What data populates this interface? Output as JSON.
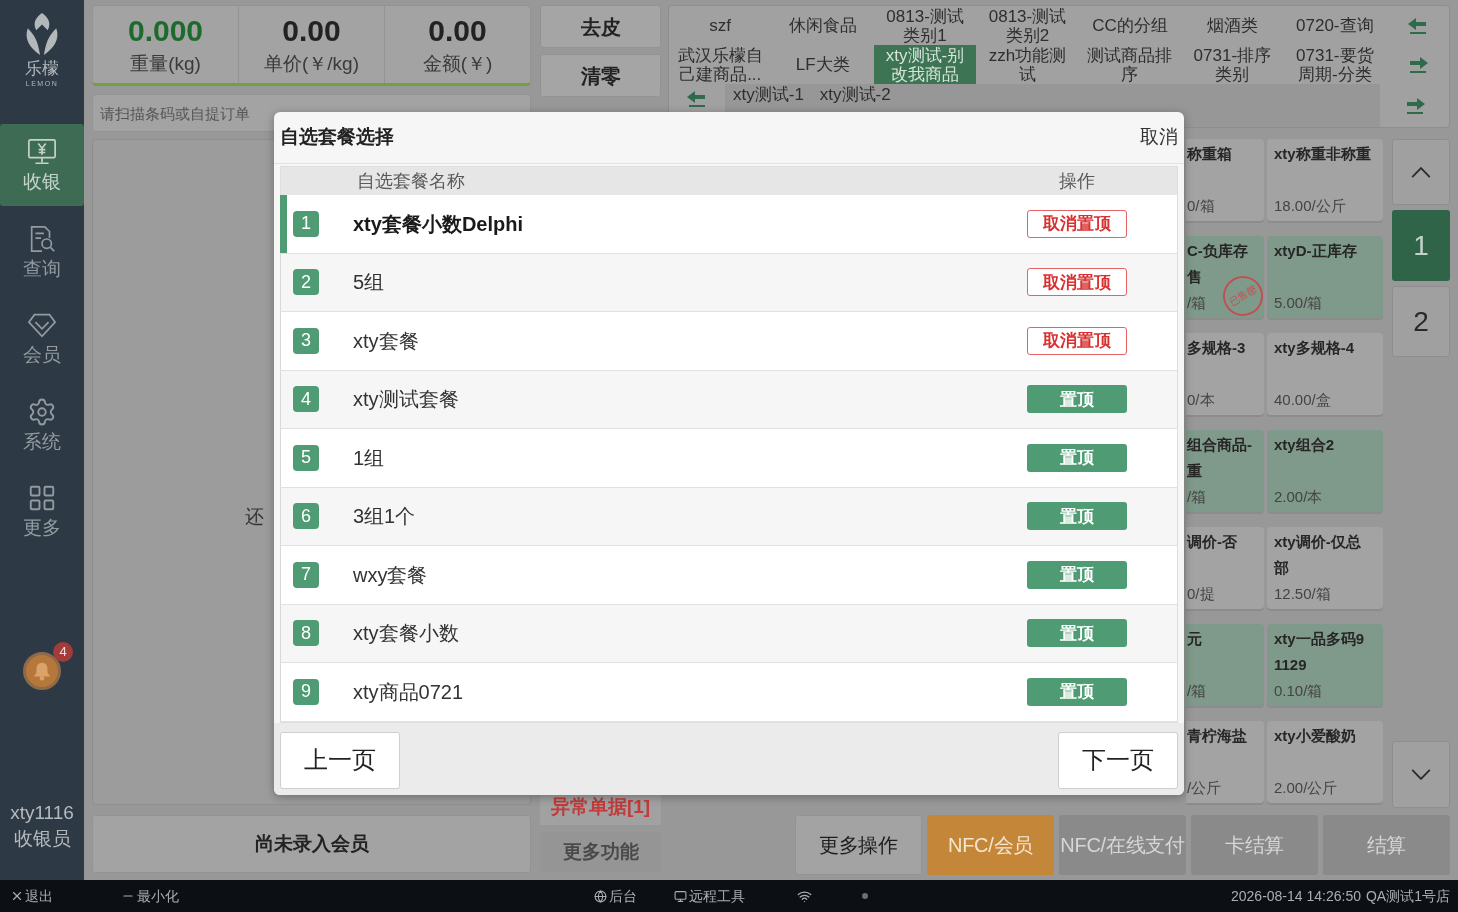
{
  "sidebar": {
    "logo": {
      "name": "乐檬",
      "subtitle": "LEMON"
    },
    "items": [
      {
        "label": "收银",
        "selected": true
      },
      {
        "label": "查询",
        "selected": false
      },
      {
        "label": "会员",
        "selected": false
      },
      {
        "label": "系统",
        "selected": false
      },
      {
        "label": "更多",
        "selected": false
      }
    ],
    "notification_count": "4",
    "user": {
      "name": "xty1116",
      "role": "收银员"
    }
  },
  "scale": {
    "readings": [
      {
        "value": "0.000",
        "label": "重量(kg)",
        "color": "#1d6b2c"
      },
      {
        "value": "0.00",
        "label": "单价(￥/kg)",
        "color": "#222222"
      },
      {
        "value": "0.00",
        "label": "金额(￥)",
        "color": "#222222"
      }
    ]
  },
  "scan_field": {
    "placeholder": "请扫描条码或自提订单"
  },
  "cart": {
    "message": "还"
  },
  "member_button": "尚未录入会员",
  "scale_buttons": [
    "去皮",
    "清零"
  ],
  "exception_button": "异常单据[1]",
  "more_functions": {
    "label": "更多功能",
    "disabled": true
  },
  "categories": {
    "rows": [
      [
        {
          "label": "szf",
          "selected": false
        },
        {
          "label": "休闲食品",
          "selected": false
        },
        {
          "label": "0813-测试类别1",
          "selected": false
        },
        {
          "label": "0813-测试类别2",
          "selected": false
        },
        {
          "label": "CC的分组",
          "selected": false
        },
        {
          "label": "烟酒类",
          "selected": false
        },
        {
          "label": "0720-查询",
          "selected": false
        }
      ],
      [
        {
          "label": "武汉乐檬自己建商品...",
          "selected": false
        },
        {
          "label": "LF大类",
          "selected": false
        },
        {
          "label": "xty测试-别改我商品",
          "selected": true
        },
        {
          "label": "zzh功能测试",
          "selected": false
        },
        {
          "label": "测试商品排序",
          "selected": false
        },
        {
          "label": "0731-排序类别",
          "selected": false
        },
        {
          "label": "0731-要货周期-分类",
          "selected": false
        }
      ]
    ],
    "subcategories": [
      "xty测试-1",
      "xty测试-2"
    ]
  },
  "products": [
    {
      "name": "称重箱",
      "price": "0/箱",
      "color": "#a3a3a3"
    },
    {
      "name": "xty称重非称重",
      "price": "18.00/公斤",
      "color": "#a3a3a3"
    },
    {
      "name": "C-负库存售",
      "price": "/箱",
      "color": "#7f9a8a",
      "stamp": "已售罄"
    },
    {
      "name": "xtyD-正库存",
      "price": "5.00/箱",
      "color": "#7f9a8a"
    },
    {
      "name": "多规格-3",
      "price": "0/本",
      "color": "#a3a3a3"
    },
    {
      "name": "xty多规格-4",
      "price": "40.00/盒",
      "color": "#a3a3a3"
    },
    {
      "name": "组合商品-重",
      "price": "/箱",
      "color": "#7f9a8a"
    },
    {
      "name": "xty组合2",
      "price": "2.00/本",
      "color": "#7f9a8a"
    },
    {
      "name": "调价-否",
      "price": "0/提",
      "color": "#a3a3a3"
    },
    {
      "name": "xty调价-仅总部",
      "price": "12.50/箱",
      "color": "#a3a3a3"
    },
    {
      "name": "元",
      "price": "/箱",
      "color": "#7f9a8a"
    },
    {
      "name": "xty一品多码91129",
      "price": "0.10/箱",
      "color": "#7f9a8a"
    },
    {
      "name": "青柠海盐",
      "price": "/公斤",
      "color": "#a3a3a3"
    },
    {
      "name": "xty小爱酸奶",
      "price": "2.00/公斤",
      "color": "#a3a3a3"
    }
  ],
  "pages": [
    {
      "label": "1",
      "selected": true
    },
    {
      "label": "2",
      "selected": false
    }
  ],
  "actions": [
    {
      "label": "更多操作",
      "kind": "plain",
      "disabled": false
    },
    {
      "label": "NFC/会员",
      "kind": "accent",
      "disabled": false
    },
    {
      "label": "NFC/在线支付",
      "kind": "plain",
      "disabled": true
    },
    {
      "label": "卡结算",
      "kind": "plain",
      "disabled": true
    },
    {
      "label": "结算",
      "kind": "plain",
      "disabled": true
    }
  ],
  "status_bar": {
    "exit": "退出",
    "minimize": "最小化",
    "backend": "后台",
    "remote_tool": "远程工具",
    "datetime": "2026-08-14 14:26:50",
    "store": "QA测试1号店"
  },
  "dialog": {
    "title": "自选套餐选择",
    "cancel": "取消",
    "columns": [
      "自选套餐名称",
      "操作"
    ],
    "rows": [
      {
        "index": "1",
        "name": "xty套餐小数Delphi",
        "action": "取消置顶",
        "pinned": true,
        "selected": true
      },
      {
        "index": "2",
        "name": "5组",
        "action": "取消置顶",
        "pinned": true,
        "selected": false
      },
      {
        "index": "3",
        "name": "xty套餐",
        "action": "取消置顶",
        "pinned": true,
        "selected": false
      },
      {
        "index": "4",
        "name": "xty测试套餐",
        "action": "置顶",
        "pinned": false,
        "selected": false
      },
      {
        "index": "5",
        "name": "1组",
        "action": "置顶",
        "pinned": false,
        "selected": false
      },
      {
        "index": "6",
        "name": "3组1个",
        "action": "置顶",
        "pinned": false,
        "selected": false
      },
      {
        "index": "7",
        "name": "wxy套餐",
        "action": "置顶",
        "pinned": false,
        "selected": false
      },
      {
        "index": "8",
        "name": "xty套餐小数",
        "action": "置顶",
        "pinned": false,
        "selected": false
      },
      {
        "index": "9",
        "name": "xty商品0721",
        "action": "置顶",
        "pinned": false,
        "selected": false
      }
    ],
    "previous": "上一页",
    "next": "下一页"
  }
}
